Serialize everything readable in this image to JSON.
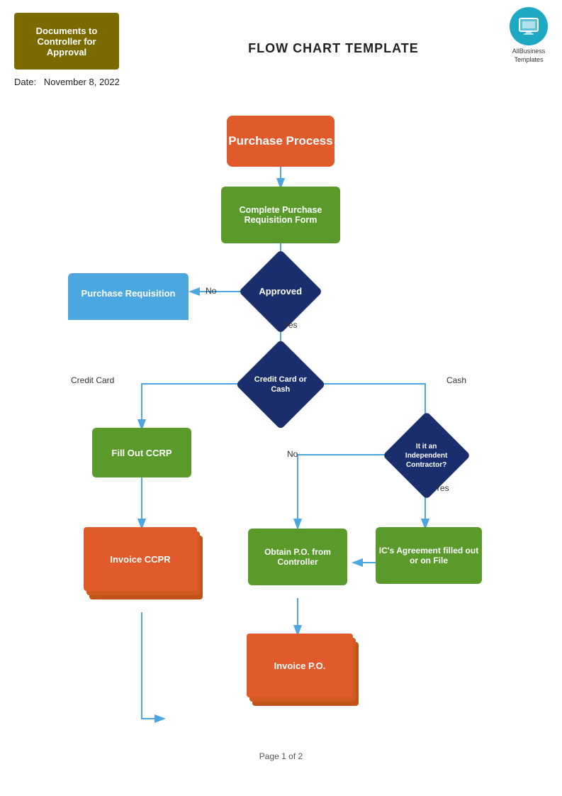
{
  "header": {
    "docs_box_label": "Documents to Controller for Approval",
    "flow_chart_title": "FLOW CHART TEMPLATE",
    "logo_alt": "AllBusiness Templates",
    "logo_line1": "AllBusiness",
    "logo_line2": "Templates"
  },
  "date": {
    "label": "Date:",
    "value": "November 8, 2022"
  },
  "flowchart": {
    "nodes": {
      "purchase_process": "Purchase Process",
      "complete_form": "Complete Purchase Requisition Form",
      "approved": "Approved",
      "purchase_req": "Purchase Requisition",
      "credit_card_or_cash": "Credit Card or Cash",
      "fill_out_ccrp": "Fill Out CCRP",
      "invoice_ccpr": "Invoice CCPR",
      "is_independent": "It it an Independent Contractor?",
      "ics_agreement": "IC's Agreement filled out or on File",
      "obtain_po": "Obtain P.O. from Controller",
      "invoice_po": "Invoice P.O."
    },
    "labels": {
      "no_approved": "No",
      "yes_approved": "Yes",
      "credit_card": "Credit Card",
      "cash": "Cash",
      "no_independent": "No",
      "yes_independent": "Yes"
    },
    "footer": "Page 1 of 2"
  },
  "colors": {
    "orange_red": "#e05a2b",
    "green": "#5a9a2b",
    "dark_navy": "#1a2e6e",
    "blue_light": "#4ca6e0",
    "docs_box": "#7a6800",
    "logo_circle": "#1da8c4"
  }
}
